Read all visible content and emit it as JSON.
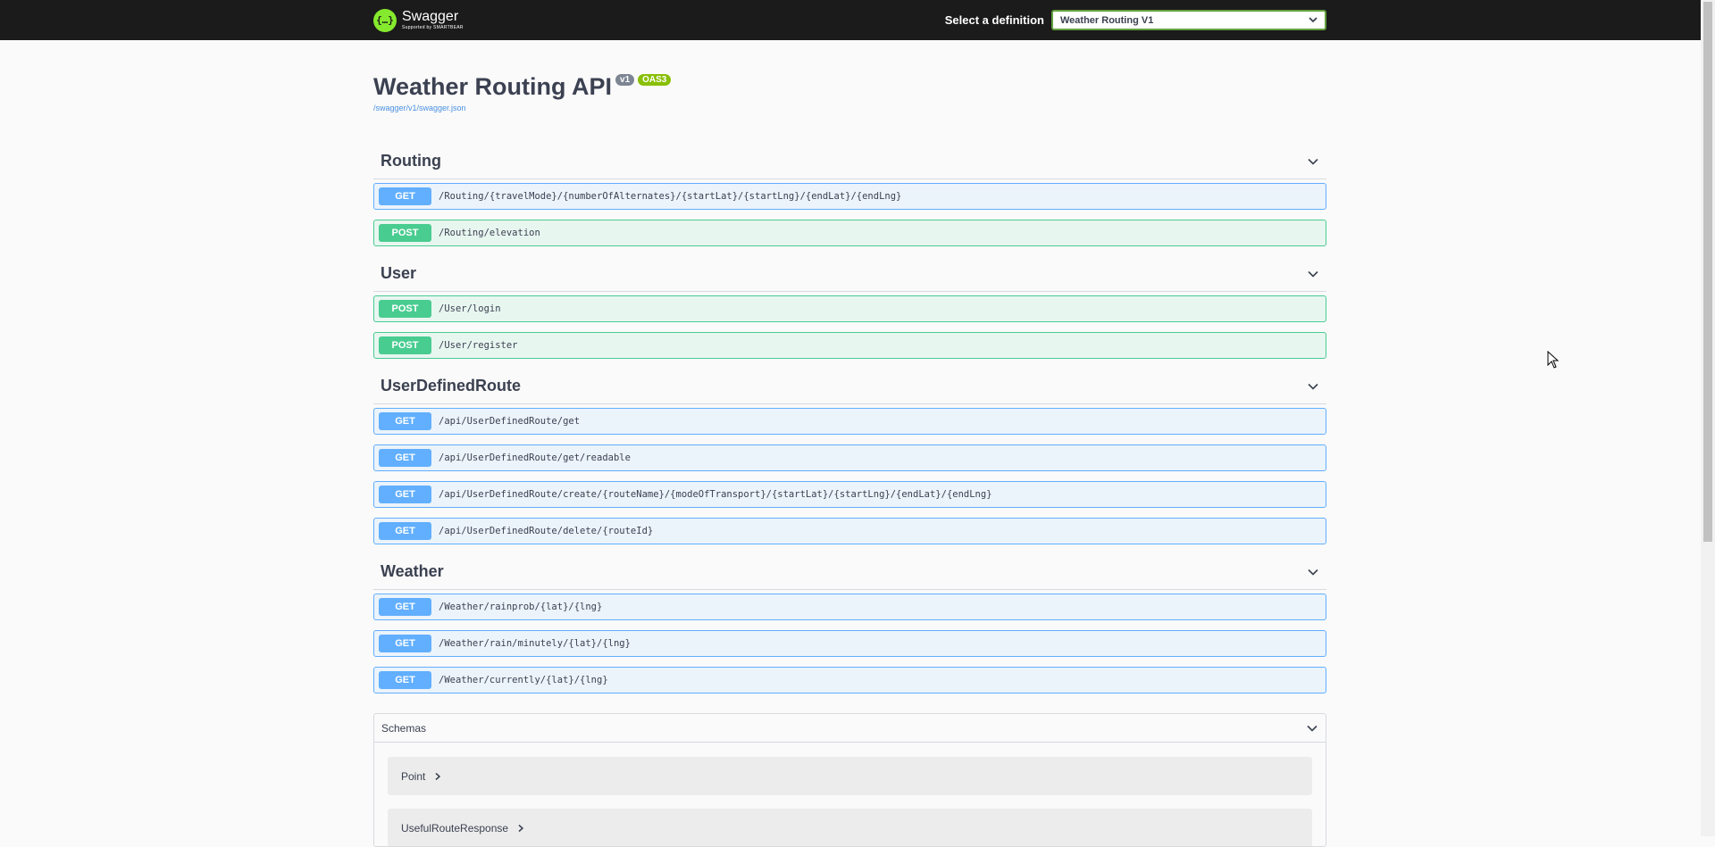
{
  "topbar": {
    "logo_title": "Swagger",
    "logo_sub": "Supported by SMARTBEAR",
    "select_label": "Select a definition",
    "selected_definition": "Weather Routing V1"
  },
  "info": {
    "title": "Weather Routing API",
    "version_badge": "v1",
    "oas_badge": "OAS3",
    "spec_url": "/swagger/v1/swagger.json"
  },
  "tags": [
    {
      "name": "Routing",
      "ops": [
        {
          "method": "GET",
          "path": "/Routing/{travelMode}/{numberOfAlternates}/{startLat}/{startLng}/{endLat}/{endLng}"
        },
        {
          "method": "POST",
          "path": "/Routing/elevation"
        }
      ]
    },
    {
      "name": "User",
      "ops": [
        {
          "method": "POST",
          "path": "/User/login"
        },
        {
          "method": "POST",
          "path": "/User/register"
        }
      ]
    },
    {
      "name": "UserDefinedRoute",
      "ops": [
        {
          "method": "GET",
          "path": "/api/UserDefinedRoute/get"
        },
        {
          "method": "GET",
          "path": "/api/UserDefinedRoute/get/readable"
        },
        {
          "method": "GET",
          "path": "/api/UserDefinedRoute/create/{routeName}/{modeOfTransport}/{startLat}/{startLng}/{endLat}/{endLng}"
        },
        {
          "method": "GET",
          "path": "/api/UserDefinedRoute/delete/{routeId}"
        }
      ]
    },
    {
      "name": "Weather",
      "ops": [
        {
          "method": "GET",
          "path": "/Weather/rainprob/{lat}/{lng}"
        },
        {
          "method": "GET",
          "path": "/Weather/rain/minutely/{lat}/{lng}"
        },
        {
          "method": "GET",
          "path": "/Weather/currently/{lat}/{lng}"
        }
      ]
    }
  ],
  "schemas": {
    "title": "Schemas",
    "models": [
      "Point",
      "UsefulRouteResponse"
    ]
  },
  "colors": {
    "get": "#61affe",
    "post": "#49cc90",
    "topbar": "#1b1b1b",
    "accent": "#85ea2d"
  }
}
